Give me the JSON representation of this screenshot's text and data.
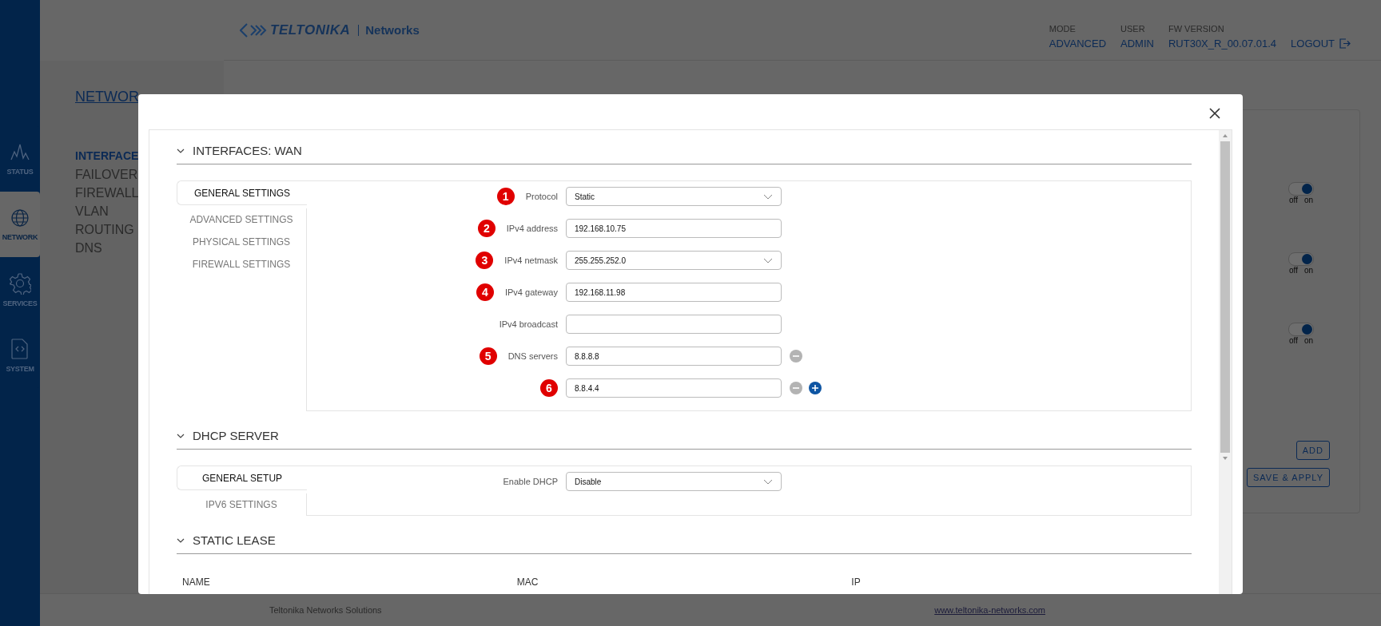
{
  "sidebar": {
    "items": [
      {
        "label": "STATUS",
        "selected": false
      },
      {
        "label": "NETWORK",
        "selected": true
      },
      {
        "label": "SERVICES",
        "selected": false
      },
      {
        "label": "SYSTEM",
        "selected": false
      }
    ]
  },
  "header": {
    "logo": "TELTONIKA",
    "logo_suffix": "Networks",
    "info": [
      {
        "label": "MODE",
        "value": "ADVANCED"
      },
      {
        "label": "USER",
        "value": "ADMIN"
      },
      {
        "label": "FW VERSION",
        "value": "RUT30X_R_00.07.01.4"
      }
    ],
    "logout": "LOGOUT"
  },
  "page": {
    "title": "NETWOR",
    "menu": [
      {
        "label": "INTERFACE",
        "selected": true
      },
      {
        "label": "FAILOVER",
        "selected": false
      },
      {
        "label": "FIREWALL",
        "selected": false
      },
      {
        "label": "VLAN",
        "selected": false
      },
      {
        "label": "ROUTING",
        "selected": false
      },
      {
        "label": "DNS",
        "selected": false
      }
    ],
    "toggles": [
      {
        "on": true,
        "off_label": "off",
        "on_label": "on"
      },
      {
        "on": true,
        "off_label": "off",
        "on_label": "on"
      },
      {
        "on": true,
        "off_label": "off",
        "on_label": "on"
      }
    ],
    "buttons": [
      "ADD",
      "SAVE & APPLY"
    ]
  },
  "modal": {
    "sections": [
      {
        "kind": "form",
        "title": "INTERFACES: WAN",
        "expanded": true,
        "tabs": [
          {
            "label": "GENERAL SETTINGS",
            "selected": true
          },
          {
            "label": "ADVANCED SETTINGS",
            "selected": false
          },
          {
            "label": "PHYSICAL SETTINGS",
            "selected": false
          },
          {
            "label": "FIREWALL SETTINGS",
            "selected": false
          }
        ],
        "fields": [
          {
            "marker": "1",
            "label": "Protocol",
            "kind": "select",
            "value": "Static"
          },
          {
            "marker": "2",
            "label": "IPv4 address",
            "kind": "text",
            "value": "192.168.10.75"
          },
          {
            "marker": "3",
            "label": "IPv4 netmask",
            "kind": "select",
            "value": "255.255.252.0"
          },
          {
            "marker": "4",
            "label": "IPv4 gateway",
            "kind": "text",
            "value": "192.168.11.98"
          },
          {
            "label": "IPv4 broadcast",
            "kind": "text"
          },
          {
            "marker": "5",
            "label": "DNS servers",
            "kind": "text",
            "value": "8.8.8.8",
            "remove": true,
            "add": false
          },
          {
            "marker": "6",
            "kind": "text",
            "value": "8.8.4.4",
            "remove": true,
            "add": true
          }
        ]
      },
      {
        "kind": "form",
        "title": "DHCP SERVER",
        "expanded": true,
        "tabs": [
          {
            "label": "GENERAL SETUP",
            "selected": true
          },
          {
            "label": "IPV6 SETTINGS",
            "selected": false
          }
        ],
        "fields": [
          {
            "label": "Enable DHCP",
            "kind": "select",
            "value": "Disable"
          }
        ]
      },
      {
        "kind": "table",
        "title": "STATIC LEASE",
        "expanded": true,
        "columns": [
          "NAME",
          "MAC",
          "IP"
        ]
      }
    ]
  },
  "footer": {
    "text": "Teltonika Networks Solutions",
    "link": "www.teltonika-networks.com"
  }
}
